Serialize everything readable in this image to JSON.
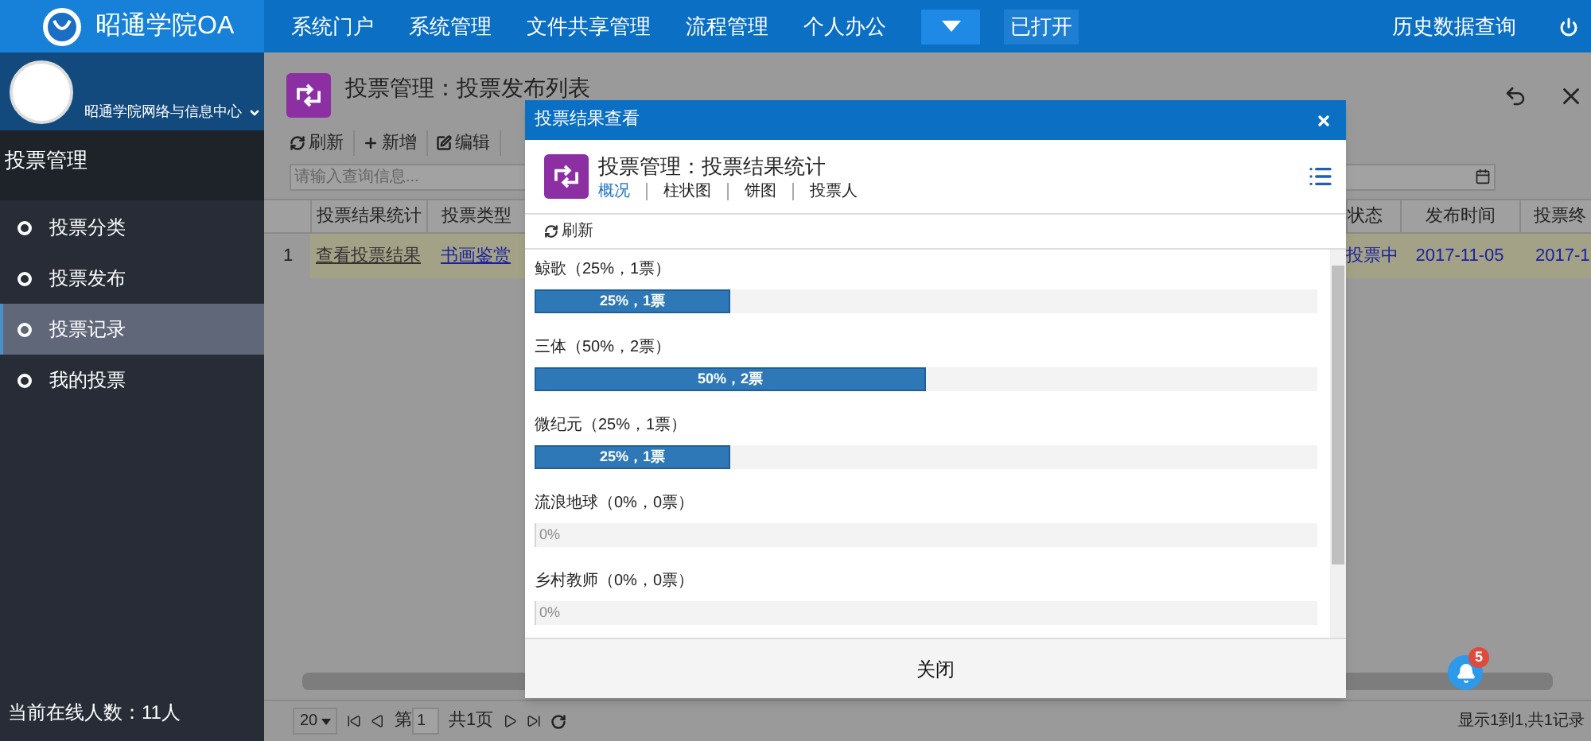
{
  "topbar": {
    "logo_text": "昭通学院OA",
    "nav": [
      {
        "label": "系统门户",
        "kind": "link"
      },
      {
        "label": "系统管理",
        "kind": "link"
      },
      {
        "label": "文件共享管理",
        "kind": "link"
      },
      {
        "label": "流程管理",
        "kind": "link"
      },
      {
        "label": "个人办公",
        "kind": "link"
      },
      {
        "kind": "dropdown"
      },
      {
        "label": "已打开",
        "kind": "box"
      }
    ],
    "right_link": "历史数据查询"
  },
  "sidebar": {
    "user": {
      "department": "昭通学院网络与信息中心"
    },
    "section": "投票管理",
    "items": [
      {
        "label": "投票分类",
        "selected": false
      },
      {
        "label": "投票发布",
        "selected": false
      },
      {
        "label": "投票记录",
        "selected": true
      },
      {
        "label": "我的投票",
        "selected": false
      }
    ],
    "footer": "当前在线人数：11人"
  },
  "page": {
    "title": "投票管理：投票发布列表",
    "toolbar": [
      "刷新",
      "新增",
      "编辑"
    ],
    "search": {
      "placeholder": "请输入查询信息..."
    },
    "table": {
      "left_columns": [
        "投票结果统计",
        "投票类型"
      ],
      "right_columns": [
        "状态",
        "发布时间",
        "投票终"
      ],
      "rows": [
        {
          "index": "1",
          "left": [
            "查看投票结果",
            "书画鉴赏"
          ],
          "right": [
            "投票中",
            "2017-11-05",
            "2017-1"
          ]
        }
      ]
    },
    "pager": {
      "page_size": "20",
      "page_label": "第",
      "page": "1",
      "total_pages": "共1页",
      "summary": "显示1到1,共1记录"
    },
    "notifications": {
      "count": "5"
    }
  },
  "dialog": {
    "title": "投票结果查看",
    "heading": "投票管理：投票结果统计",
    "tabs": [
      {
        "label": "概况",
        "selected": true
      },
      {
        "label": "柱状图",
        "selected": false
      },
      {
        "label": "饼图",
        "selected": false
      },
      {
        "label": "投票人",
        "selected": false
      }
    ],
    "refresh": "刷新",
    "options": [
      {
        "label": "鲸歌（25%，1票）",
        "bar_text": "25%，1票",
        "level": 0.25
      },
      {
        "label": "三体（50%，2票）",
        "bar_text": "50%，2票",
        "level": 0.5
      },
      {
        "label": "微纪元（25%，1票）",
        "bar_text": "25%，1票",
        "level": 0.25
      },
      {
        "label": "流浪地球（0%，0票）",
        "bar_text": "0%",
        "level": 0
      },
      {
        "label": "乡村教师（0%，0票）",
        "bar_text": "0%",
        "level": 0
      }
    ],
    "close_button": "关闭"
  }
}
